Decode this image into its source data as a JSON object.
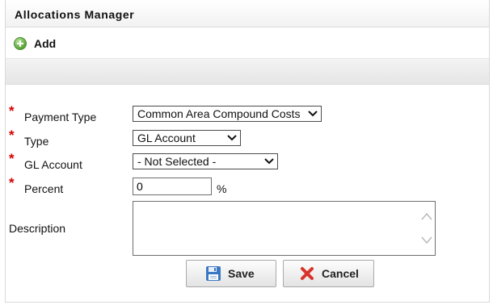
{
  "window": {
    "title": "Allocations Manager"
  },
  "toolbar": {
    "add_label": "Add",
    "add_icon": "plus-circle-icon"
  },
  "form": {
    "payment_type": {
      "label": "Payment Type",
      "value": "Common Area Compound Costs",
      "required": "*"
    },
    "type": {
      "label": "Type",
      "value": "GL Account",
      "required": "*"
    },
    "gl_account": {
      "label": "GL Account",
      "value": "- Not Selected -",
      "required": "*"
    },
    "percent": {
      "label": "Percent",
      "value": "0",
      "unit": "%",
      "required": "*"
    },
    "description": {
      "label": "Description",
      "value": ""
    }
  },
  "buttons": {
    "save": {
      "label": "Save",
      "icon": "floppy-disk-icon"
    },
    "cancel": {
      "label": "Cancel",
      "icon": "red-x-icon"
    }
  },
  "colors": {
    "required": "#d40000",
    "add_icon": "#5aa53a",
    "save_icon": "#3b78c4",
    "cancel_icon": "#d9342b"
  }
}
